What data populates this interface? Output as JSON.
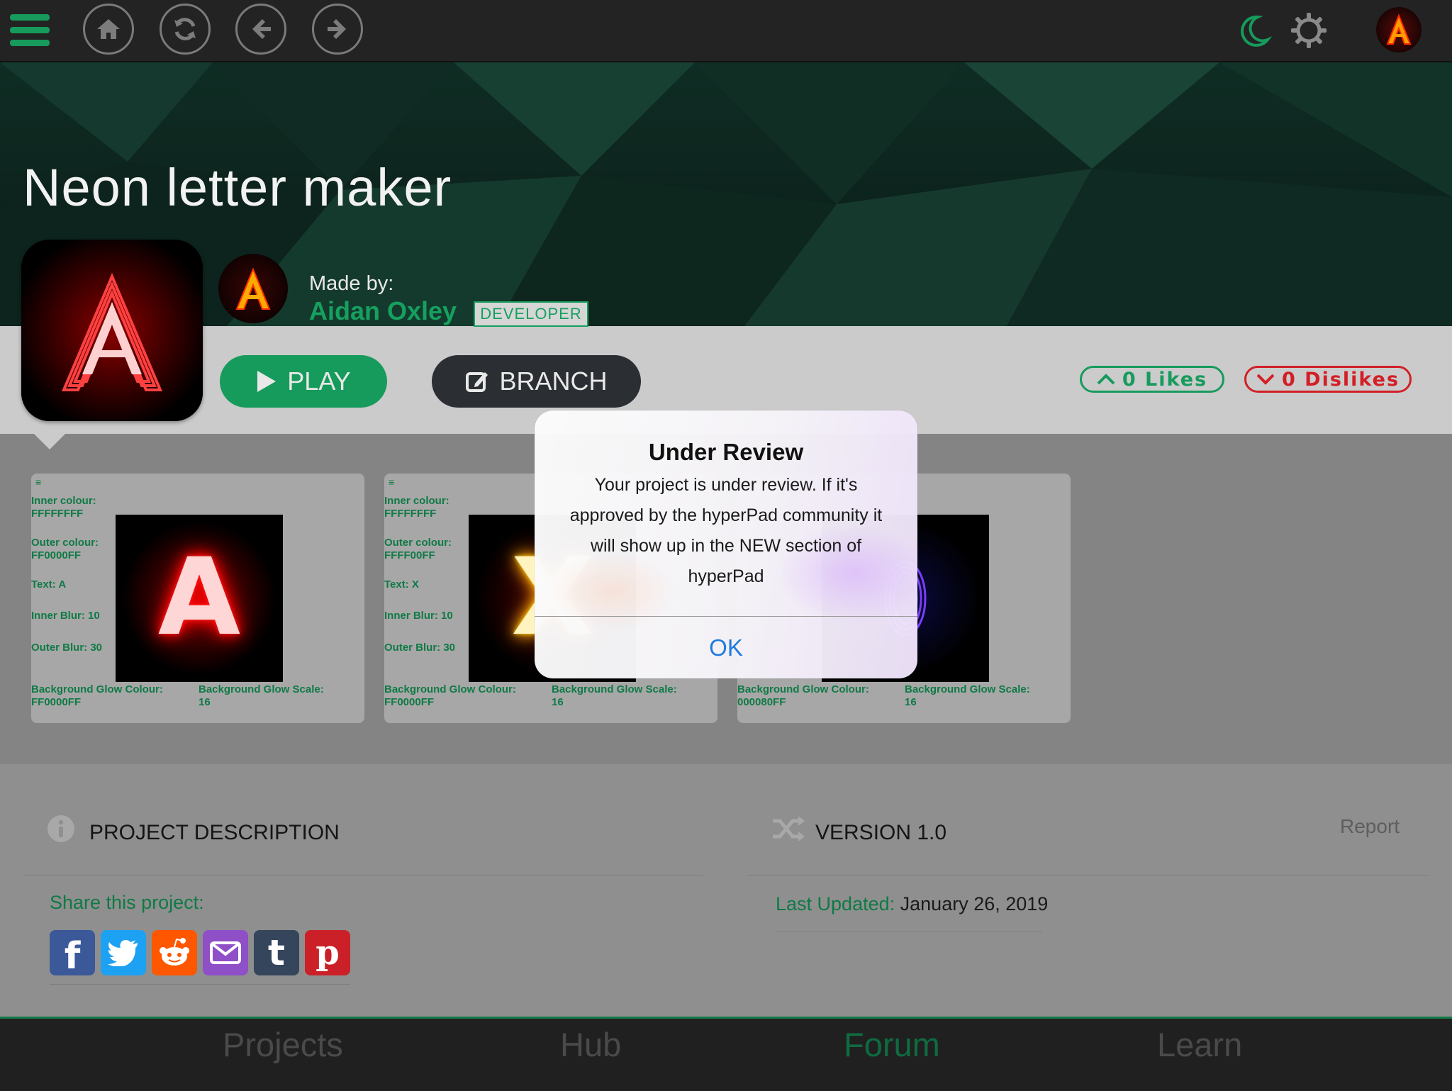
{
  "topbar": {
    "menu_icon": "hamburger-menu-icon",
    "home_icon": "home-icon",
    "refresh_icon": "refresh-icon",
    "back_icon": "arrow-left-icon",
    "forward_icon": "arrow-right-icon",
    "theme_icon": "moon-icon",
    "settings_icon": "gear-icon",
    "profile_icon": "avatar"
  },
  "project": {
    "title": "Neon letter maker",
    "made_by_label": "Made by:",
    "author": "Aidan Oxley",
    "author_badge": "DEVELOPER",
    "play_label": "PLAY",
    "branch_label": "BRANCH",
    "likes_label": "0 Likes",
    "dislikes_label": "0 Dislikes"
  },
  "gallery": [
    {
      "menu": "≡",
      "inner_label": "Inner colour:",
      "inner_value": "FFFFFFFF",
      "outer_label": "Outer colour:",
      "outer_value": "FF0000FF",
      "text_label": "Text: A",
      "inner_blur": "Inner Blur: 10",
      "outer_blur": "Outer Blur: 30",
      "bg_glow_colour_label": "Background Glow Colour:",
      "bg_glow_colour_value": "FF0000FF",
      "bg_glow_scale_label": "Background Glow Scale:",
      "bg_glow_scale_value": "16",
      "preview_letter": "A",
      "preview_color": "#ff1a1a"
    },
    {
      "menu": "≡",
      "inner_label": "Inner colour:",
      "inner_value": "FFFFFFFF",
      "outer_label": "Outer colour:",
      "outer_value": "FFFF00FF",
      "text_label": "Text: X",
      "inner_blur": "Inner Blur: 10",
      "outer_blur": "Outer Blur: 30",
      "bg_glow_colour_label": "Background Glow Colour:",
      "bg_glow_colour_value": "FF0000FF",
      "bg_glow_scale_label": "Background Glow Scale:",
      "bg_glow_scale_value": "16",
      "preview_letter": "X",
      "preview_color": "#ffd21a"
    },
    {
      "bg_glow_colour_label": "Background Glow Colour:",
      "bg_glow_colour_value": "000080FF",
      "bg_glow_scale_label": "Background Glow Scale:",
      "bg_glow_scale_value": "16",
      "preview_color": "#5a2bff"
    }
  ],
  "description": {
    "heading": "PROJECT DESCRIPTION",
    "share_label": "Share this project:",
    "share_icons": [
      "facebook-icon",
      "twitter-icon",
      "reddit-icon",
      "email-icon",
      "tumblr-icon",
      "pinterest-icon"
    ]
  },
  "version": {
    "heading": "VERSION 1.0",
    "report_label": "Report",
    "last_updated_label": "Last Updated:",
    "last_updated_value": "January 26, 2019"
  },
  "bottom_nav": [
    "Projects",
    "Hub",
    "Forum",
    "Learn"
  ],
  "modal": {
    "title": "Under Review",
    "body": "Your project is under review. If it's approved by the hyperPad community it will show up in the NEW section of hyperPad",
    "ok_label": "OK"
  },
  "colors": {
    "brand_green": "#169b5c",
    "dislike_red": "#d21f26",
    "ios_blue": "#1f7adf"
  }
}
